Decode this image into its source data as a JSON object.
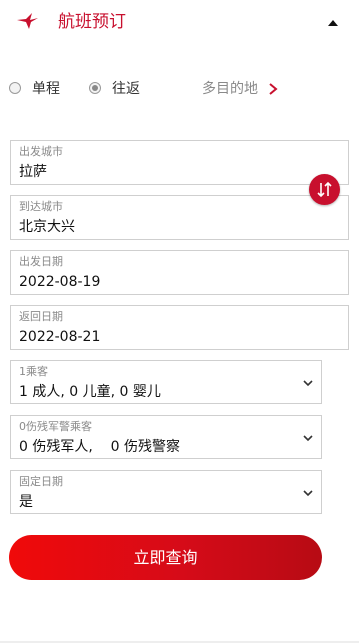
{
  "header": {
    "title": "航班预订",
    "logo_icon": "airline-bird-logo-icon",
    "collapse_icon": "caret-up-icon"
  },
  "trip_type": {
    "one_way_label": "单程",
    "round_trip_label": "往返",
    "multi_city_label": "多目的地",
    "selected": "往返"
  },
  "origin": {
    "label": "出发城市",
    "value": "拉萨"
  },
  "destination": {
    "label": "到达城市",
    "value": "北京大兴"
  },
  "depart_date": {
    "label": "出发日期",
    "value": "2022-08-19"
  },
  "return_date": {
    "label": "返回日期",
    "value": "2022-08-21"
  },
  "passengers": {
    "label": "1乘客",
    "value": "1 成人, 0 儿童, 0 婴儿"
  },
  "disabled_passengers": {
    "label": "0伤残军警乘客",
    "value": "0 伤残军人,    0 伤残警察"
  },
  "fixed_date": {
    "label": "固定日期",
    "value": "是"
  },
  "search_button": {
    "label": "立即查询"
  },
  "colors": {
    "brand": "#c8102e",
    "button": "#e00a10"
  }
}
